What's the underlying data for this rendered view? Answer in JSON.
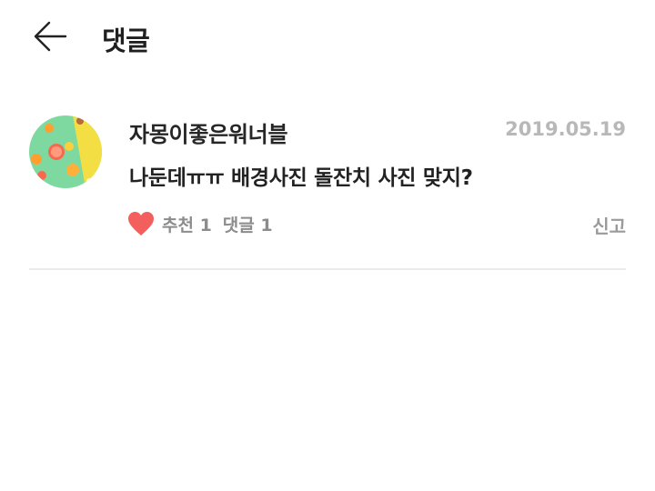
{
  "header": {
    "title": "댓글",
    "back_icon": "arrow-left-icon"
  },
  "comment": {
    "author": "자몽이좋은워너블",
    "date": "2019.05.19",
    "text": "나둔데ㅠㅠ 배경사진 돌잔치 사진 맞지?",
    "like_icon": "heart-icon",
    "like_color": "#f25f5c",
    "likes_label": "추천 1",
    "replies_label": "댓글 1",
    "report_label": "신고"
  }
}
